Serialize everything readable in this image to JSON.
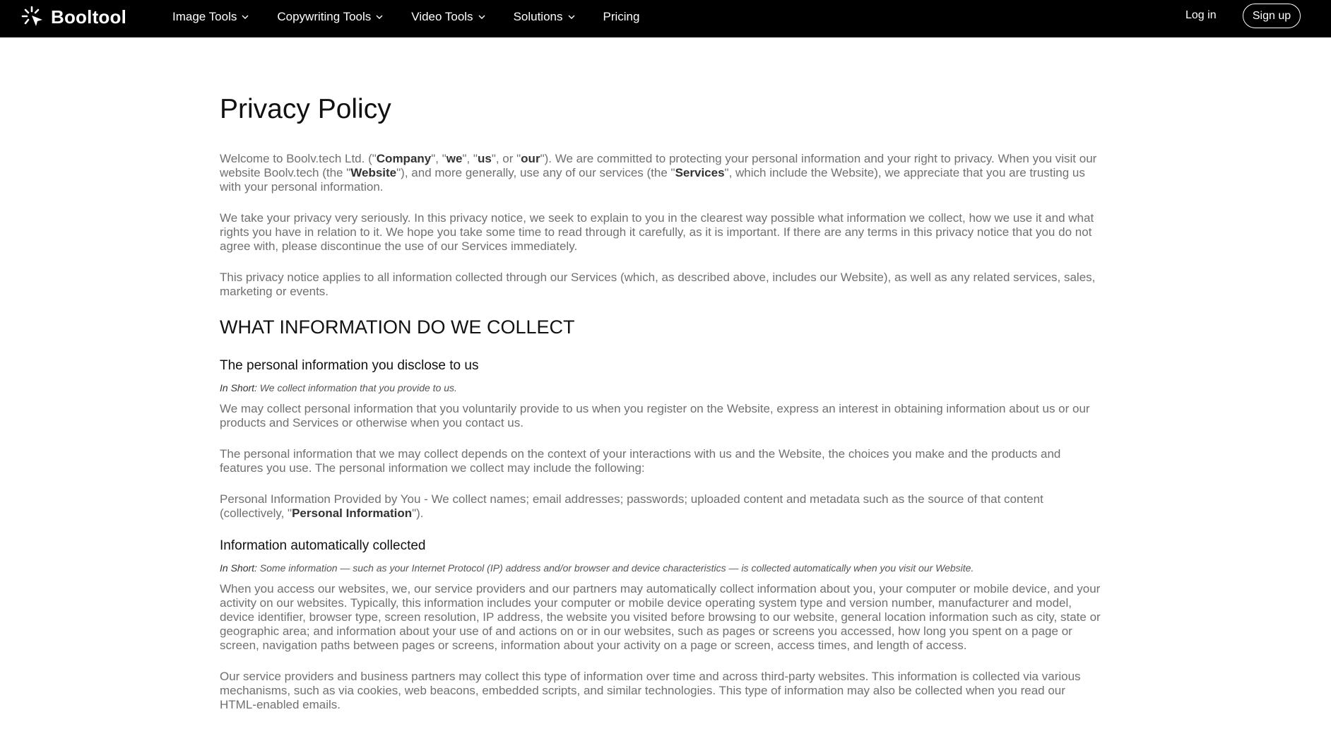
{
  "header": {
    "brand": "Booltool",
    "nav": [
      {
        "label": "Image Tools",
        "has_dropdown": true
      },
      {
        "label": "Copywriting Tools",
        "has_dropdown": true
      },
      {
        "label": "Video Tools",
        "has_dropdown": true
      },
      {
        "label": "Solutions",
        "has_dropdown": true
      },
      {
        "label": "Pricing",
        "has_dropdown": false
      }
    ],
    "login_label": "Log in",
    "signup_label": "Sign up"
  },
  "page": {
    "title": "Privacy Policy",
    "intro": [
      {
        "parts": [
          {
            "t": "Welcome to Boolv.tech Ltd. (\""
          },
          {
            "t": "Company",
            "b": true
          },
          {
            "t": "\", \""
          },
          {
            "t": "we",
            "b": true
          },
          {
            "t": "\", \""
          },
          {
            "t": "us",
            "b": true
          },
          {
            "t": "\", or \""
          },
          {
            "t": "our",
            "b": true
          },
          {
            "t": "\"). We are committed to protecting your personal information and your right to privacy. When you visit our website Boolv.tech (the \""
          },
          {
            "t": "Website",
            "b": true
          },
          {
            "t": "\"), and more generally, use any of our services (the \""
          },
          {
            "t": "Services",
            "b": true
          },
          {
            "t": "\", which include the Website), we appreciate that you are trusting us with your personal information."
          }
        ]
      },
      {
        "parts": [
          {
            "t": "We take your privacy very seriously. In this privacy notice, we seek to explain to you in the clearest way possible what information we collect, how we use it and what rights you have in relation to it. We hope you take some time to read through it carefully, as it is important. If there are any terms in this privacy notice that you do not agree with, please discontinue the use of our Services immediately."
          }
        ]
      },
      {
        "parts": [
          {
            "t": "This privacy notice applies to all information collected through our Services (which, as described above, includes our Website), as well as any related services, sales, marketing or events."
          }
        ]
      }
    ],
    "section_title": "WHAT INFORMATION DO WE COLLECT",
    "subsections": [
      {
        "title": "The personal information you disclose to us",
        "short_lead": "In Short:",
        "short_text": " We collect information that you provide to us.",
        "paragraphs": [
          {
            "parts": [
              {
                "t": "We may collect personal information that you voluntarily provide to us when you register on the Website, express an interest in obtaining information about us or our products and Services or otherwise when you contact us."
              }
            ]
          },
          {
            "parts": [
              {
                "t": "The personal information that we may collect depends on the context of your interactions with us and the Website, the choices you make and the products and features you use. The personal information we collect may include the following:"
              }
            ]
          },
          {
            "parts": [
              {
                "t": "Personal Information Provided by You - We collect names; email addresses; passwords; uploaded content and metadata such as the source of that content (collectively, \""
              },
              {
                "t": "Personal Information",
                "b": true
              },
              {
                "t": "\")."
              }
            ]
          }
        ]
      },
      {
        "title": "Information automatically collected",
        "short_lead": "In Short:",
        "short_text": " Some information — such as your Internet Protocol (IP) address and/or browser and device characteristics — is collected automatically when you visit our Website.",
        "paragraphs": [
          {
            "parts": [
              {
                "t": "When you access our websites, we, our service providers and our partners may automatically collect information about you, your computer or mobile device, and your activity on our websites. Typically, this information includes your computer or mobile device operating system type and version number, manufacturer and model, device identifier, browser type, screen resolution, IP address, the website you visited before browsing to our website, general location information such as city, state or geographic area; and information about your use of and actions on or in our websites, such as pages or screens you accessed, how long you spent on a page or screen, navigation paths between pages or screens, information about your activity on a page or screen, access times, and length of access."
              }
            ]
          },
          {
            "parts": [
              {
                "t": "Our service providers and business partners may collect this type of information over time and across third-party websites. This information is collected via various mechanisms, such as via cookies, web beacons, embedded scripts, and similar technologies. This type of information may also be collected when you read our HTML-enabled emails."
              }
            ]
          }
        ]
      }
    ]
  }
}
